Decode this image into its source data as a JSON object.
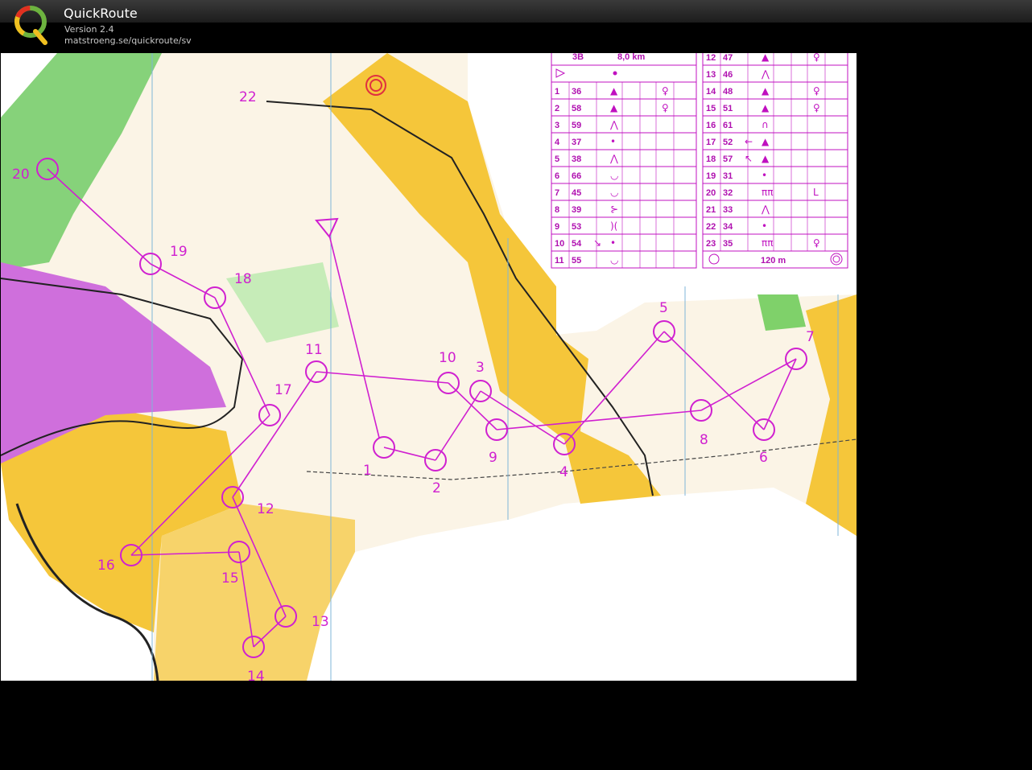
{
  "app": {
    "title": "QuickRoute",
    "version": "Version 2.4",
    "url": "matstroeng.se/quickroute/sv",
    "logo_letter": "Q"
  },
  "colors": {
    "course": "#d020d0",
    "forest_open": "#f5c63a",
    "green": "#7fd16a",
    "olive_restricted": "#cf6fdc"
  },
  "map": {
    "controls": [
      {
        "label": "1"
      },
      {
        "label": "2"
      },
      {
        "label": "3"
      },
      {
        "label": "4"
      },
      {
        "label": "5"
      },
      {
        "label": "6"
      },
      {
        "label": "7"
      },
      {
        "label": "8"
      },
      {
        "label": "9"
      },
      {
        "label": "10"
      },
      {
        "label": "11"
      },
      {
        "label": "12"
      },
      {
        "label": "13"
      },
      {
        "label": "14"
      },
      {
        "label": "15"
      },
      {
        "label": "16"
      },
      {
        "label": "17"
      },
      {
        "label": "18"
      },
      {
        "label": "19"
      },
      {
        "label": "20"
      },
      {
        "label": "22"
      }
    ]
  },
  "description_sheet": {
    "class": "3B",
    "length": "8,0 km",
    "left_rows": [
      {
        "n": "1",
        "code": "36",
        "sym": "▲",
        "extra": "♀"
      },
      {
        "n": "2",
        "code": "58",
        "sym": "▲",
        "extra": "♀"
      },
      {
        "n": "3",
        "code": "59",
        "sym": "⋀",
        "extra": ""
      },
      {
        "n": "4",
        "code": "37",
        "sym": "•",
        "extra": ""
      },
      {
        "n": "5",
        "code": "38",
        "sym": "⋀",
        "extra": ""
      },
      {
        "n": "6",
        "code": "66",
        "sym": "◡",
        "extra": ""
      },
      {
        "n": "7",
        "code": "45",
        "sym": "◡",
        "extra": ""
      },
      {
        "n": "8",
        "code": "39",
        "sym": "⊱",
        "extra": ""
      },
      {
        "n": "9",
        "code": "53",
        "sym": ")(",
        "extra": ""
      },
      {
        "n": "10",
        "code": "54",
        "sym": "•",
        "extra": "↘"
      },
      {
        "n": "11",
        "code": "55",
        "sym": "◡",
        "extra": ""
      }
    ],
    "right_rows": [
      {
        "n": "12",
        "code": "47",
        "sym": "▲",
        "extra": "♀"
      },
      {
        "n": "13",
        "code": "46",
        "sym": "⋀",
        "extra": ""
      },
      {
        "n": "14",
        "code": "48",
        "sym": "▲",
        "extra": "♀"
      },
      {
        "n": "15",
        "code": "51",
        "sym": "▲",
        "extra": "♀"
      },
      {
        "n": "16",
        "code": "61",
        "sym": "∩",
        "extra": ""
      },
      {
        "n": "17",
        "code": "52",
        "sym": "▲",
        "extra": "←"
      },
      {
        "n": "18",
        "code": "57",
        "sym": "▲",
        "extra": "↖"
      },
      {
        "n": "19",
        "code": "31",
        "sym": "•",
        "extra": ""
      },
      {
        "n": "20",
        "code": "32",
        "sym": "ππ",
        "extra": "L"
      },
      {
        "n": "21",
        "code": "33",
        "sym": "⋀",
        "extra": ""
      },
      {
        "n": "22",
        "code": "34",
        "sym": "•",
        "extra": ""
      },
      {
        "n": "23",
        "code": "35",
        "sym": "ππ",
        "extra": "♀"
      }
    ],
    "finish_distance": "120 m"
  }
}
